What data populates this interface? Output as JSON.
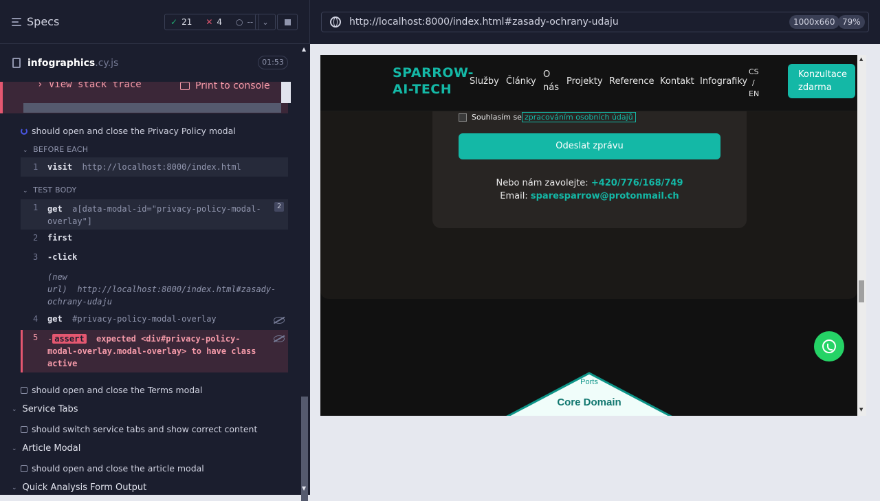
{
  "runner": {
    "header": {
      "title": "Specs"
    },
    "stats": {
      "passed": "21",
      "failed": "4",
      "pending": "--"
    },
    "file": {
      "name": "infographics",
      "ext": ".cy.js",
      "time": "01:53"
    },
    "error": {
      "stack_label": "View stack trace",
      "console_label": "Print to console"
    },
    "current_test": "should open and close the Privacy Policy modal",
    "before_each_label": "BEFORE EACH",
    "test_body_label": "TEST BODY",
    "before_cmds": [
      {
        "num": "1",
        "name": "visit",
        "arg": "http://localhost:8000/index.html"
      }
    ],
    "body_cmds": [
      {
        "num": "1",
        "name": "get",
        "arg": "a[data-modal-id=\"privacy-policy-modal-overlay\"]",
        "badge": "2"
      },
      {
        "num": "2",
        "name": "first",
        "arg": ""
      },
      {
        "num": "3",
        "name": "-click",
        "arg": ""
      },
      {
        "num": "",
        "name": "(new url)",
        "arg": "http://localhost:8000/index.html#zasady-ochrany-udaju"
      },
      {
        "num": "4",
        "name": "get",
        "arg": "#privacy-policy-modal-overlay"
      }
    ],
    "assert": {
      "num": "5",
      "prefix": "-",
      "tag": "assert",
      "text": "expected <div#privacy-policy-modal-overlay.modal-overlay> to have class active"
    },
    "tests_after": [
      {
        "type": "test",
        "label": "should open and close the Terms modal"
      },
      {
        "type": "suite",
        "label": "Service Tabs"
      },
      {
        "type": "test",
        "label": "should switch service tabs and show correct content"
      },
      {
        "type": "suite",
        "label": "Article Modal"
      },
      {
        "type": "test",
        "label": "should open and close the article modal"
      },
      {
        "type": "suite",
        "label": "Quick Analysis Form Output"
      }
    ]
  },
  "browser": {
    "url": "http://localhost:8000/index.html#zasady-ochrany-udaju",
    "dims": "1000x660",
    "zoom": "79%"
  },
  "site": {
    "logo_line1": "SPARROW-",
    "logo_line2": "AI-TECH",
    "nav": [
      "Služby",
      "Články",
      "O",
      "nás",
      "Projekty",
      "Reference",
      "Kontakt",
      "Infografiky"
    ],
    "lang": [
      "CS",
      "/",
      "EN"
    ],
    "cta_line1": "Konzultace",
    "cta_line2": "zdarma",
    "consent_text": "Souhlasím se",
    "consent_link": "zpracováním osobních údajů",
    "send_label": "Odeslat zprávu",
    "call_prefix": "Nebo nám zavolejte:",
    "phone": "+420/776/168/749",
    "email_prefix": "Email:",
    "email": "sparesparrow@protonmail.ch",
    "diagram_ports": "Ports",
    "diagram_core": "Core Domain",
    "colors": {
      "accent": "#14b8a6",
      "whatsapp": "#25d366",
      "fail": "#e45770",
      "pass": "#1fa971"
    }
  }
}
